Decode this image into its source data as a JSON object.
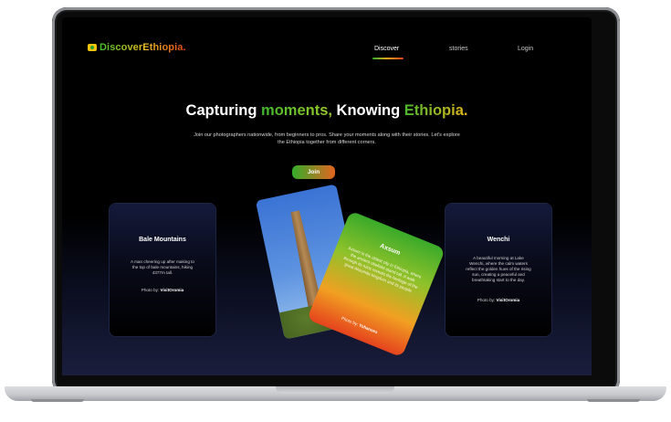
{
  "brand": {
    "name": "DiscoverEthiopia."
  },
  "nav": {
    "items": [
      {
        "label": "Discover",
        "active": true
      },
      {
        "label": "stories",
        "active": false
      },
      {
        "label": "Login",
        "active": false
      }
    ]
  },
  "hero": {
    "part1": "Capturing ",
    "part2": "moments,",
    "part3": " Knowing ",
    "part4": "Ethiopia.",
    "subtitle": "Join our photographers nationwide, from beginners to pros. Share your moments along with their stories. Let's explore the Ethiopia together from different corners.",
    "join_label": "Join"
  },
  "cards": {
    "left": {
      "title": "Bale Mountains",
      "desc": "A man cheering up after making to the top of bale mountains, hiking 4377m tall.",
      "credit_prefix": "Photo by:",
      "credit_name": "VisitOromia"
    },
    "center": {
      "title": "Axsum",
      "desc": "Axsum is the oldest city in Ethiopia, where the ancient obelisks stand tall. A walk through its ruins reveals the heritage of the great Aksumite kingdom and its people.",
      "credit_prefix": "Photo by:",
      "credit_name": "Yohannes"
    },
    "right": {
      "title": "Wenchi",
      "desc": "A beautiful morning at Lake Wenchi, where the calm waters reflect the golden hues of the rising sun, creating a peaceful and breathtaking start to the day.",
      "credit_prefix": "Photo by:",
      "credit_name": "VisitOromia"
    }
  },
  "colors": {
    "accent_green": "#3fb82a",
    "accent_orange": "#e6591e",
    "accent_gold": "#e8c020"
  }
}
